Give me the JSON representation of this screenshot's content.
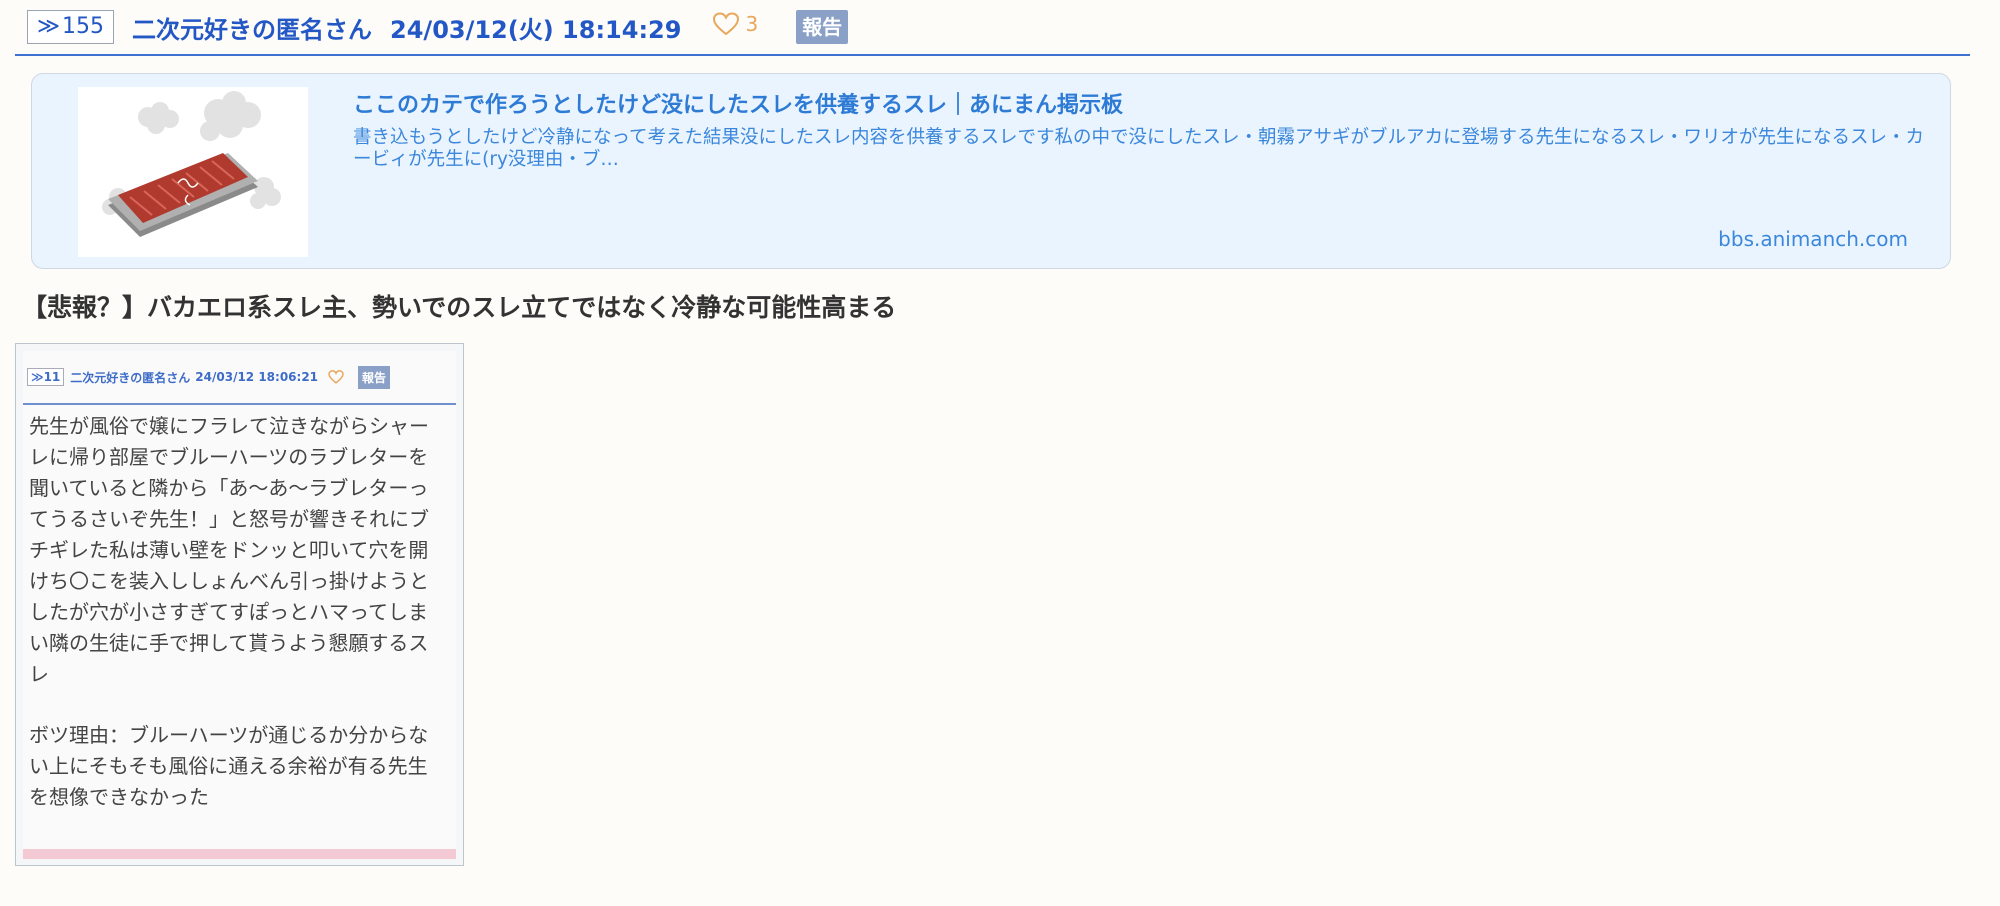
{
  "post": {
    "res_arrow": "≫",
    "res_number": "155",
    "poster_name": "二次元好きの匿名さん",
    "date": "24/03/12(火) 18:14:29",
    "like_count": "3",
    "report_label": "報告",
    "text": "【悲報？】バカエロ系スレ主、勢いでのスレ立てではなく冷静な可能性高まる"
  },
  "link_card": {
    "title": "ここのカテで作ろうとしたけど没にしたスレを供養するスレ｜あにまん掲示板",
    "description": "書き込もうとしたけど冷静になって考えた結果没にしたスレ内容を供養するスレです私の中で没にしたスレ・朝霧アサギがブルアカに登場する先生になるスレ・ワリオが先生になるスレ・カービィが先生に(ry没理由・ブ…",
    "domain": "bbs.animanch.com",
    "thumbnail_icon": "burnt-food-plate-icon"
  },
  "embedded_image": {
    "header": {
      "res_arrow": "≫",
      "res_number": "11",
      "poster_name": "二次元好きの匿名さん",
      "date": "24/03/12 18:06:21",
      "report_label": "報告"
    },
    "paragraphs": [
      "先生が風俗で嬢にフラレて泣きながらシャーレに帰り部屋でブルーハーツのラブレターを聞いていると隣から「あ〜あ〜ラブレターってうるさいぞ先生！」と怒号が響きそれにブチギレた私は薄い壁をドンッと叩いて穴を開けち〇こを装入ししょんべん引っ掛けようとしたが穴が小さすぎてすぽっとハマってしまい隣の生徒に手で押して貰うよう懇願するスレ",
      "ボツ理由：ブルーハーツが通じるか分からない上にそもそも風俗に通える余裕が有る先生を想像できなかった"
    ]
  },
  "colors": {
    "accent": "#2357c5",
    "link": "#2e7bd6",
    "card_bg": "#eaf4ff",
    "heart": "#e8a75c",
    "report_bg": "#8aa0c6"
  }
}
